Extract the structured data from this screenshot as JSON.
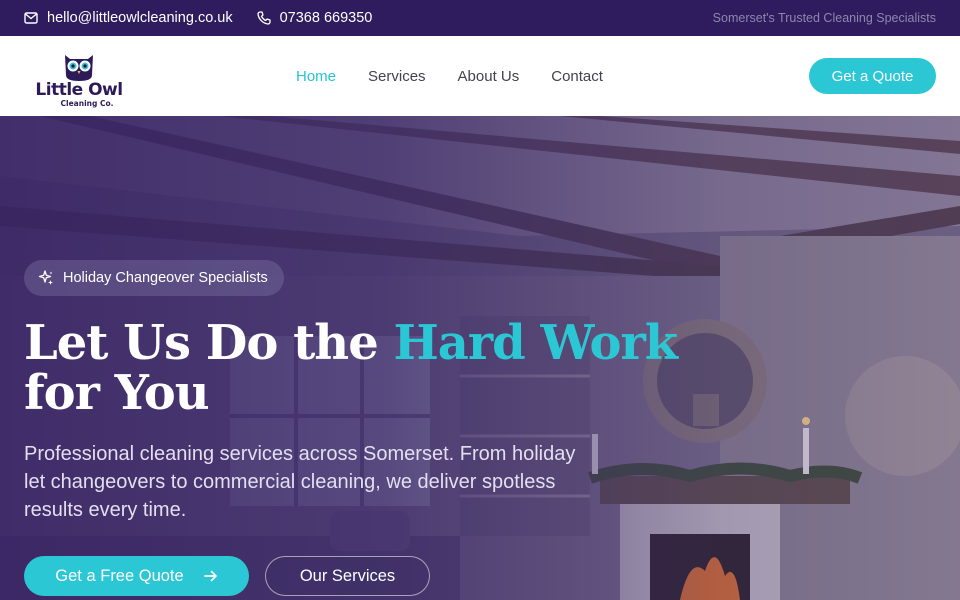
{
  "topbar": {
    "email": "hello@littleowlcleaning.co.uk",
    "phone": "07368 669350",
    "tagline": "Somerset's Trusted Cleaning Specialists"
  },
  "header": {
    "logo_name": "Little Owl",
    "logo_sub": "Cleaning Co.",
    "nav": [
      {
        "label": "Home",
        "active": true
      },
      {
        "label": "Services",
        "active": false
      },
      {
        "label": "About Us",
        "active": false
      },
      {
        "label": "Contact",
        "active": false
      }
    ],
    "quote_button": "Get a Quote"
  },
  "hero": {
    "badge": "Holiday Changeover Specialists",
    "headline_part1": "Let Us Do the ",
    "headline_accent": "Hard Work",
    "headline_part2": " for You",
    "subtext": "Professional cleaning services across Somerset. From holiday let changeovers to commercial cleaning, we deliver spotless results every time.",
    "primary_button": "Get a Free Quote",
    "secondary_button": "Our Services"
  },
  "colors": {
    "brand_dark": "#2e1c5e",
    "accent": "#2bc7d4"
  },
  "icons": [
    "mail-icon",
    "phone-icon",
    "sparkles-icon",
    "arrow-right-icon",
    "owl-logo-icon"
  ]
}
